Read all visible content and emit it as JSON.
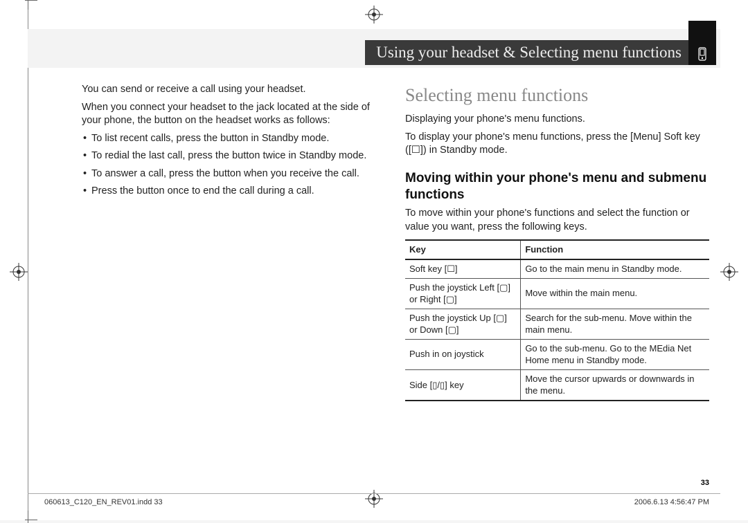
{
  "header": {
    "title": "Using your headset & Selecting menu functions"
  },
  "left": {
    "p1": "You can send or receive a call using your headset.",
    "p2": "When you connect your headset to the jack located at the side of your phone, the button on the headset works as follows:",
    "bullets": [
      "To list recent calls, press the button in Standby mode.",
      "To redial the last call, press the button twice in Standby mode.",
      "To answer a call, press the button when you receive the call.",
      "Press the button once to end the call during a call."
    ]
  },
  "right": {
    "section_title": "Selecting menu functions",
    "p1": "Displaying your phone's menu functions.",
    "p2": "To display your phone's menu functions, press the [Menu] Soft key ([☐]) in Standby mode.",
    "sub_title": "Moving within your phone's menu and submenu functions",
    "p3": "To move within your phone's functions and select the function or value you want, press the following keys.",
    "table": {
      "head_key": "Key",
      "head_fn": "Function",
      "rows": [
        {
          "key": "Soft key [☐]",
          "fn": "Go to the main menu in Standby mode."
        },
        {
          "key": "Push the joystick Left [▢] or Right [▢]",
          "fn": "Move within the main menu."
        },
        {
          "key": "Push the joystick Up [▢] or Down [▢]",
          "fn": "Search for the sub-menu. Move within the main menu."
        },
        {
          "key": "Push in on joystick",
          "fn": "Go to the sub-menu. Go to the MEdia Net Home menu in Standby mode."
        },
        {
          "key": "Side [▯/▯] key",
          "fn": "Move the cursor upwards or downwards in the menu."
        }
      ]
    }
  },
  "page_number": "33",
  "footer": {
    "left": "060613_C120_EN_REV01.indd   33",
    "right": "2006.6.13   4:56:47 PM"
  }
}
